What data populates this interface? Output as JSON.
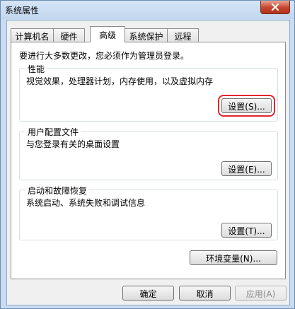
{
  "window": {
    "title": "系统属性"
  },
  "tabs": [
    {
      "label": "计算机名"
    },
    {
      "label": "硬件"
    },
    {
      "label": "高级"
    },
    {
      "label": "系统保护"
    },
    {
      "label": "远程"
    }
  ],
  "active_tab": "高级",
  "admin_note": "要进行大多数更改，您必须作为管理员登录。",
  "performance": {
    "title": "性能",
    "description": "视觉效果，处理器计划，内存使用，以及虚拟内存",
    "button": "设置(S)..."
  },
  "user_profiles": {
    "title": "用户配置文件",
    "description": "与您登录有关的桌面设置",
    "button": "设置(E)..."
  },
  "startup_recovery": {
    "title": "启动和故障恢复",
    "description": "系统启动、系统失败和调试信息",
    "button": "设置(T)..."
  },
  "env_button": "环境变量(N)...",
  "dialog": {
    "ok": "确定",
    "cancel": "取消",
    "apply": "应用(A)"
  },
  "colors": {
    "highlight": "#e4252b",
    "window_frame": "#c9dcf0"
  }
}
